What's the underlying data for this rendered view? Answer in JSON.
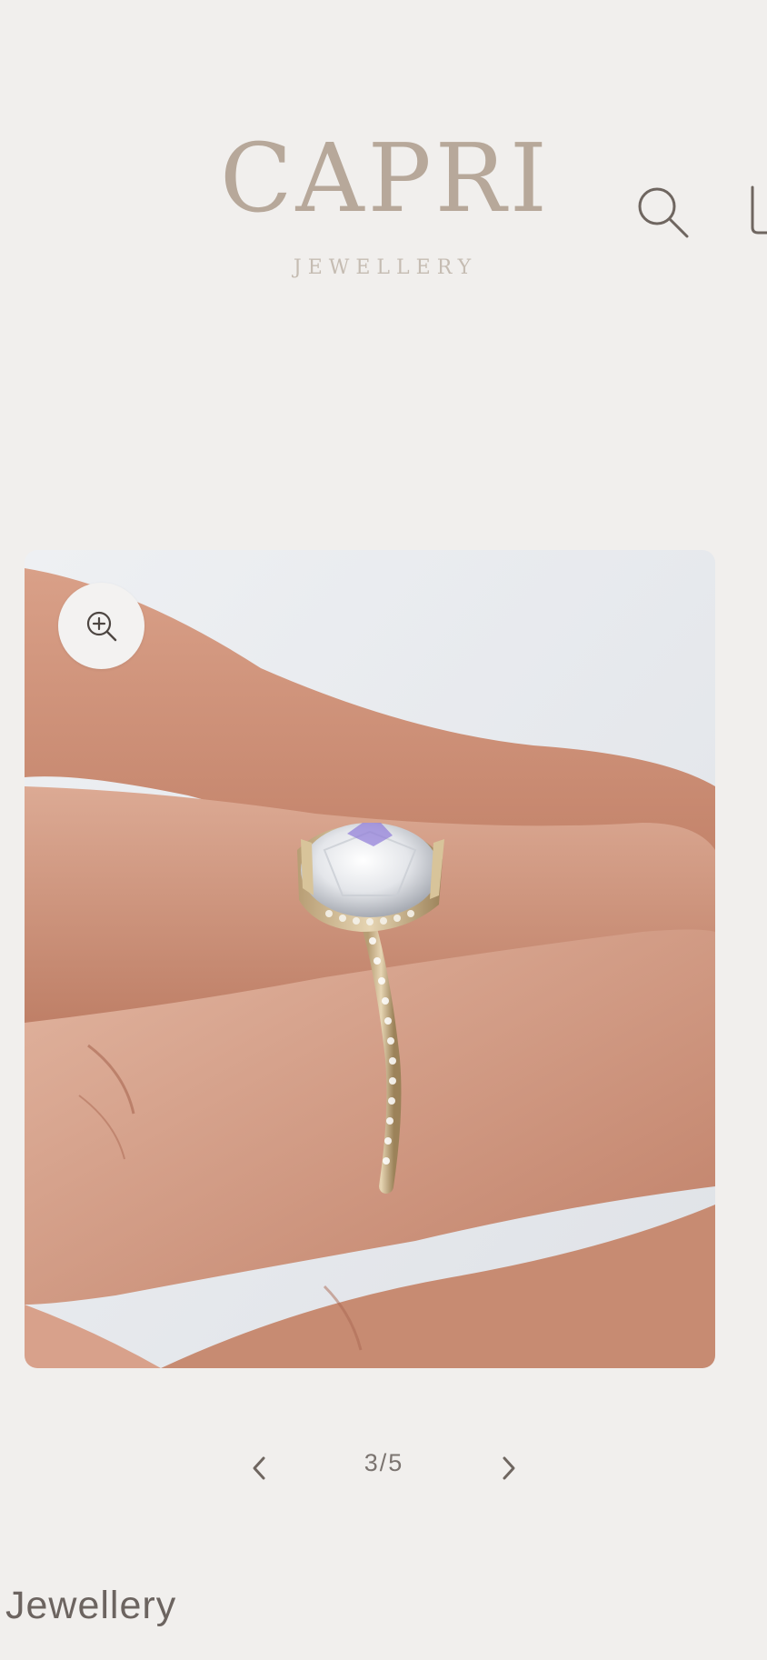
{
  "header": {
    "logo_main": "CAPRI",
    "logo_sub": "JEWELLERY",
    "search_icon": "search-icon",
    "cart_icon": "cart-icon",
    "colors": {
      "logo": "#b7a89a",
      "icon": "#6f6660",
      "background": "#f1efed"
    }
  },
  "gallery": {
    "zoom_icon": "zoom-in-icon",
    "image_alt": "diamond-ring-on-hand"
  },
  "pager": {
    "prev_icon": "chevron-left-icon",
    "next_icon": "chevron-right-icon",
    "count": "3/5",
    "current": 3,
    "total": 5
  },
  "product": {
    "vendor": "Jewellery"
  }
}
